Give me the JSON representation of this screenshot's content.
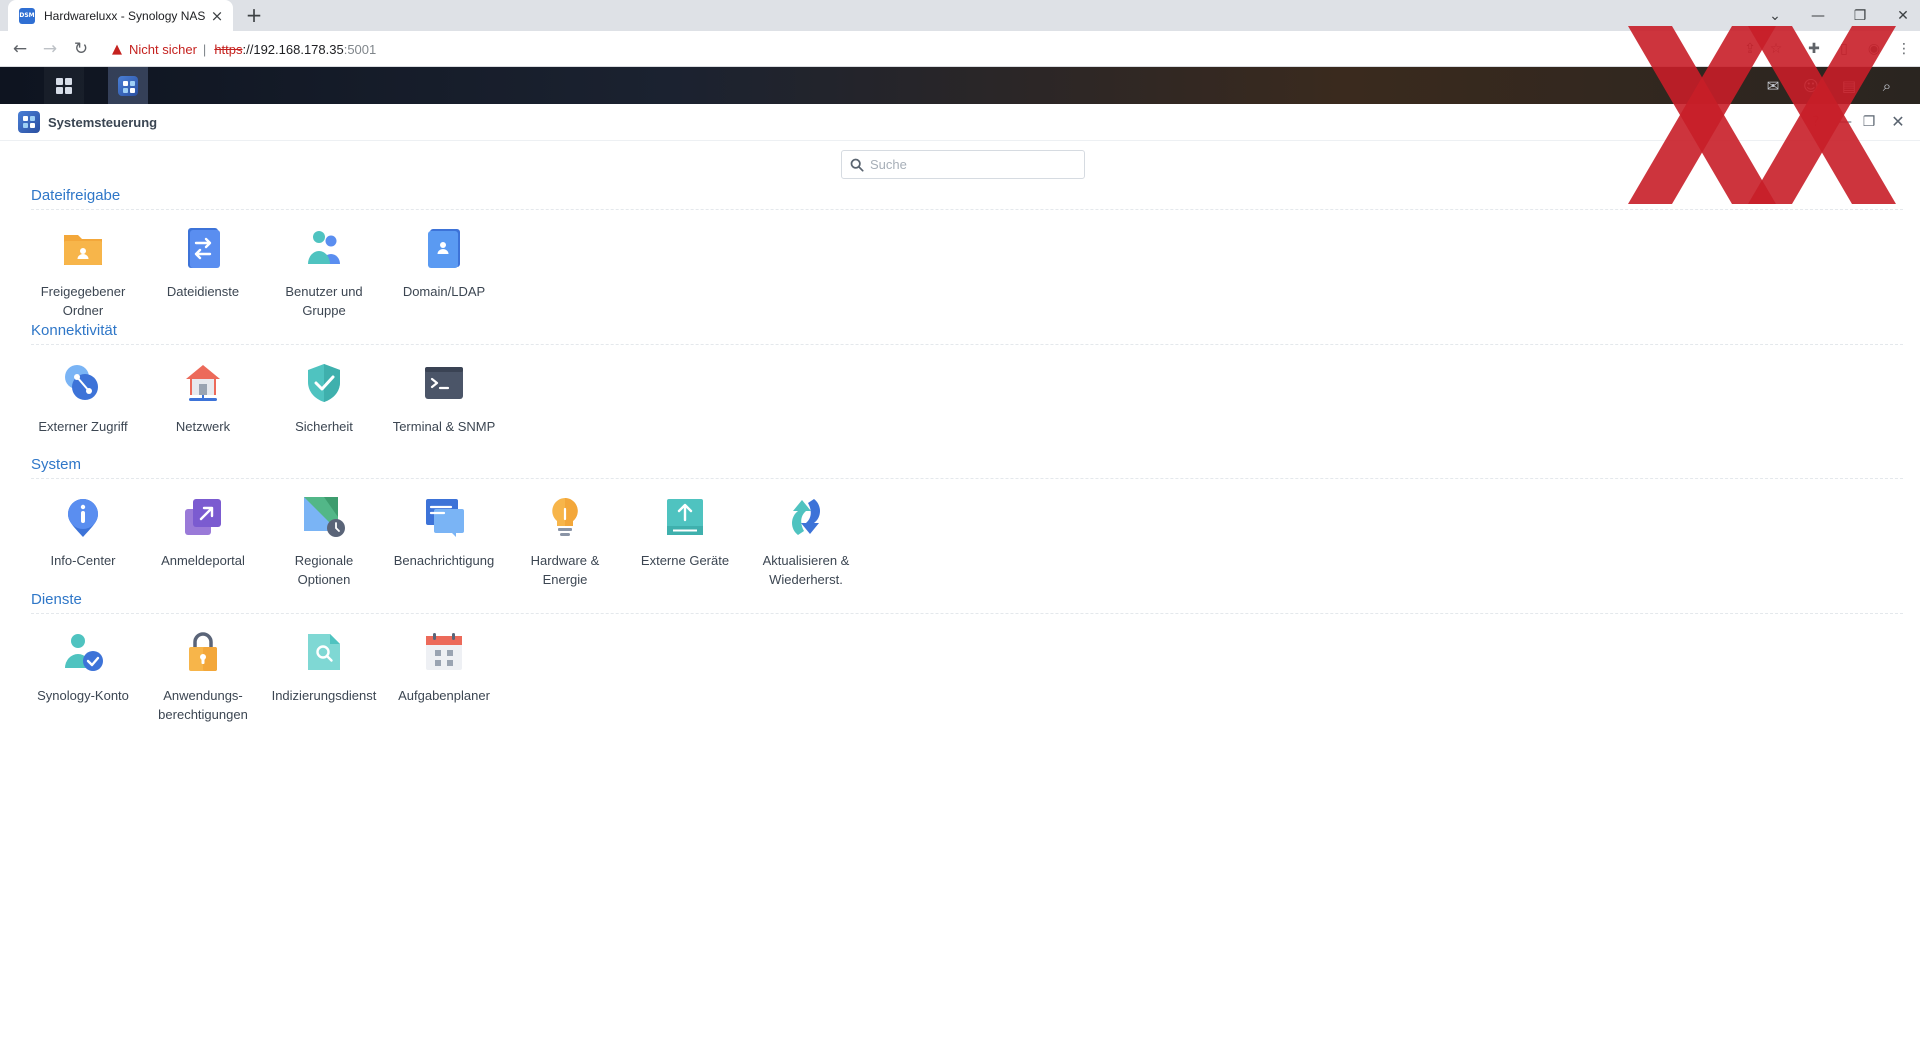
{
  "browser": {
    "tab_title": "Hardwareluxx - Synology NAS",
    "tab_favicon_text": "DSM",
    "not_secure": "Nicht sicher",
    "url_scheme": "https",
    "url_host": "://192.168.178.35",
    "url_port": ":5001"
  },
  "window": {
    "title": "Systemsteuerung"
  },
  "search": {
    "placeholder": "Suche"
  },
  "sections": {
    "file_sharing": {
      "title": "Dateifreigabe",
      "items": [
        "Freigegebener Ordner",
        "Dateidienste",
        "Benutzer und Gruppe",
        "Domain/LDAP"
      ]
    },
    "connectivity": {
      "title": "Konnektivität",
      "items": [
        "Externer Zugriff",
        "Netzwerk",
        "Sicherheit",
        "Terminal & SNMP"
      ]
    },
    "system": {
      "title": "System",
      "items": [
        "Info-Center",
        "Anmeldeportal",
        "Regionale Optionen",
        "Benachrichtigung",
        "Hardware & Energie",
        "Externe Geräte",
        "Aktualisieren & Wiederherst."
      ]
    },
    "services": {
      "title": "Dienste",
      "items": [
        "Synology-Konto",
        "Anwendungs-berechtigungen",
        "Indizierungsdienst",
        "Aufgabenplaner"
      ]
    }
  },
  "colors": {
    "section_title": "#2f77c8",
    "watermark": "#c81e28"
  }
}
